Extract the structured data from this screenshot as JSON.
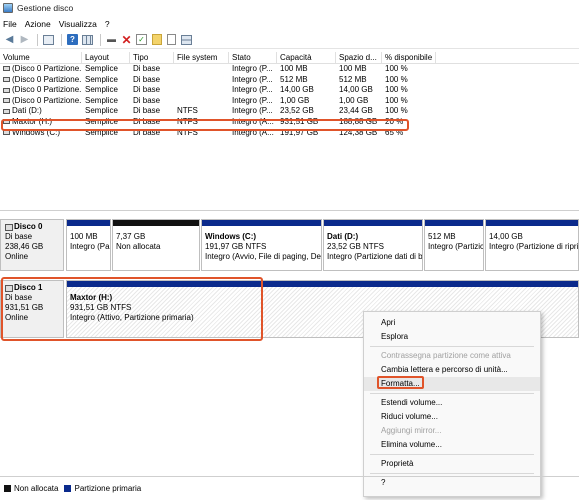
{
  "window": {
    "title": "Gestione disco"
  },
  "menu": [
    "File",
    "Azione",
    "Visualizza",
    "?"
  ],
  "volumes": {
    "columns": [
      "Volume",
      "Layout",
      "Tipo",
      "File system",
      "Stato",
      "Capacità",
      "Spazio d...",
      "% disponibile"
    ],
    "rows": [
      [
        "(Disco 0 Partizione...",
        "Semplice",
        "Di base",
        "",
        "Integro (P...",
        "100 MB",
        "100 MB",
        "100 %"
      ],
      [
        "(Disco 0 Partizione...",
        "Semplice",
        "Di base",
        "",
        "Integro (P...",
        "512 MB",
        "512 MB",
        "100 %"
      ],
      [
        "(Disco 0 Partizione...",
        "Semplice",
        "Di base",
        "",
        "Integro (P...",
        "14,00 GB",
        "14,00 GB",
        "100 %"
      ],
      [
        "(Disco 0 Partizione...",
        "Semplice",
        "Di base",
        "",
        "Integro (P...",
        "1,00 GB",
        "1,00 GB",
        "100 %"
      ],
      [
        "Dati (D:)",
        "Semplice",
        "Di base",
        "NTFS",
        "Integro (P...",
        "23,52 GB",
        "23,44 GB",
        "100 %"
      ],
      [
        "Maxtor (H:)",
        "Semplice",
        "Di base",
        "NTFS",
        "Integro (A...",
        "931,51 GB",
        "188,88 GB",
        "20 %"
      ],
      [
        "Windows (C:)",
        "Semplice",
        "Di base",
        "NTFS",
        "Integro (A...",
        "191,97 GB",
        "124,38 GB",
        "65 %"
      ]
    ]
  },
  "disk0": {
    "name": "Disco 0",
    "type": "Di base",
    "size": "238,46 GB",
    "status": "Online",
    "partitions": [
      {
        "title": "",
        "size": "100 MB",
        "status": "Integro (Pa"
      },
      {
        "title": "",
        "size": "7,37 GB",
        "status": "Non allocata"
      },
      {
        "title": "Windows (C:)",
        "size": "191,97 GB NTFS",
        "status": "Integro (Avvio, File di paging, Det"
      },
      {
        "title": "Dati (D:)",
        "size": "23,52 GB NTFS",
        "status": "Integro (Partizione dati di base)"
      },
      {
        "title": "",
        "size": "512 MB",
        "status": "Integro (Partizic"
      },
      {
        "title": "",
        "size": "14,00 GB",
        "status": "Integro (Partizione di ripri"
      }
    ]
  },
  "disk1": {
    "name": "Disco 1",
    "type": "Di base",
    "size": "931,51 GB",
    "status": "Online",
    "partition": {
      "title": "Maxtor (H:)",
      "size": "931,51 GB NTFS",
      "status": "Integro (Attivo, Partizione primaria)"
    }
  },
  "context_menu": {
    "items": [
      {
        "label": "Apri",
        "enabled": true
      },
      {
        "label": "Esplora",
        "enabled": true
      },
      {
        "label": "Contrassegna partizione come attiva",
        "enabled": false
      },
      {
        "label": "Cambia lettera e percorso di unità...",
        "enabled": true
      },
      {
        "label": "Formatta...",
        "enabled": true
      },
      {
        "label": "Estendi volume...",
        "enabled": true
      },
      {
        "label": "Riduci volume...",
        "enabled": true
      },
      {
        "label": "Aggiungi mirror...",
        "enabled": false
      },
      {
        "label": "Elimina volume...",
        "enabled": true
      },
      {
        "label": "Proprietà",
        "enabled": true
      },
      {
        "label": "?",
        "enabled": true
      }
    ]
  },
  "legend": [
    {
      "label": "Non allocata",
      "color": "#111111"
    },
    {
      "label": "Partizione primaria",
      "color": "#0b2a8c"
    }
  ],
  "colors": {
    "highlight": "#e0542a",
    "primary": "#0b2a8c",
    "unallocated": "#111111"
  }
}
